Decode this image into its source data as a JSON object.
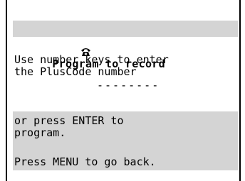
{
  "screen": {
    "title": "Program to record",
    "title_icon": "telephone-icon",
    "instruction_line1": "Use number keys to enter",
    "instruction_line2": "the PlusCode number",
    "code_placeholder": "--------",
    "enter_line1": "or press ENTER to",
    "enter_line2": "program.",
    "back_line": "Press MENU to go back."
  },
  "colors": {
    "band": "#d4d4d4",
    "text": "#000000",
    "background": "#ffffff"
  }
}
